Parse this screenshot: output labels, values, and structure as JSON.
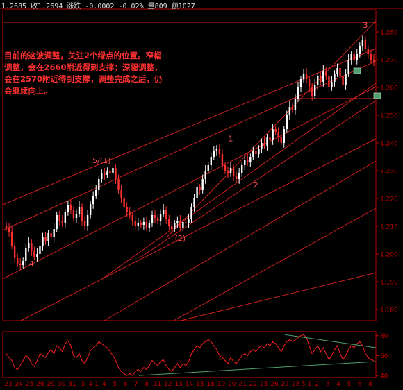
{
  "header": {
    "info": "1.2685 收1.2694 涨跌 -0.0002 -0.02% 量809 额1027"
  },
  "annotation": {
    "text": "目前的这波调整，关注2个绿点的位置。窄幅调整，会在2660附近得到支撑；深幅调整，会在2570附近得到支撑，调整完成之后，仍会继续向上。"
  },
  "colors": {
    "background": "#000000",
    "axis": "#c00000",
    "trendline": "#d02020",
    "candle_up": "#ffffff",
    "candle_down": "#ff3030",
    "wave_label": "#ff5050",
    "target": "#50a070",
    "osc_line": "#ff2020",
    "osc_trend": "#50a070"
  },
  "chart_data": [
    {
      "type": "candlestick",
      "title": "",
      "ylim": [
        1.176,
        1.288
      ],
      "yticks": [
        1.18,
        1.19,
        1.2,
        1.21,
        1.22,
        1.23,
        1.24,
        1.25,
        1.26,
        1.27,
        1.28
      ],
      "ytick_labels": [
        "1.180",
        "1.190",
        "1.200",
        "1.210",
        "1.220",
        "1.230",
        "1.240",
        "1.250",
        "1.260",
        "1.270",
        "1.280"
      ],
      "x_labels": [
        "23",
        "24",
        "25",
        "26",
        "29",
        "30",
        "31",
        "3",
        "4-1",
        "4",
        "5",
        "6",
        "7",
        "8",
        "11",
        "12",
        "13",
        "14",
        "15",
        "18",
        "19",
        "20",
        "21",
        "22",
        "25",
        "26",
        "27",
        "28",
        "5-1",
        "2",
        "3",
        "4",
        "5",
        "6",
        "8"
      ],
      "closes": [
        1.2095,
        1.208,
        1.203,
        1.1985,
        1.1965,
        1.196,
        1.1975,
        1.202,
        1.204,
        1.201,
        1.199,
        1.2,
        1.203,
        1.206,
        1.2045,
        1.2075,
        1.206,
        1.209,
        1.214,
        1.212,
        1.211,
        1.215,
        1.2175,
        1.216,
        1.213,
        1.2145,
        1.217,
        1.212,
        1.21,
        1.214,
        1.218,
        1.221,
        1.223,
        1.227,
        1.229,
        1.2285,
        1.23,
        1.229,
        1.231,
        1.227,
        1.223,
        1.22,
        1.217,
        1.215,
        1.214,
        1.212,
        1.21,
        1.211,
        1.2105,
        1.2115,
        1.2095,
        1.211,
        1.214,
        1.213,
        1.212,
        1.2145,
        1.216,
        1.2125,
        1.21,
        1.209,
        1.211,
        1.212,
        1.2095,
        1.2115,
        1.211,
        1.2125,
        1.217,
        1.22,
        1.224,
        1.223,
        1.227,
        1.23,
        1.232,
        1.235,
        1.237,
        1.238,
        1.236,
        1.232,
        1.23,
        1.229,
        1.231,
        1.228,
        1.227,
        1.229,
        1.232,
        1.234,
        1.233,
        1.235,
        1.237,
        1.236,
        1.238,
        1.24,
        1.239,
        1.242,
        1.241,
        1.245,
        1.244,
        1.242,
        1.24,
        1.245,
        1.25,
        1.253,
        1.252,
        1.256,
        1.26,
        1.263,
        1.265,
        1.263,
        1.26,
        1.257,
        1.261,
        1.264,
        1.262,
        1.266,
        1.264,
        1.26,
        1.262,
        1.265,
        1.267,
        1.264,
        1.261,
        1.265,
        1.27,
        1.272,
        1.27,
        1.272,
        1.275,
        1.277,
        1.274,
        1.272,
        1.27,
        1.2694
      ],
      "wave_labels": [
        {
          "text": "4",
          "x_index": 9,
          "y": 1.1955
        },
        {
          "text": "5/(1)",
          "x_index": 34,
          "y": 1.2328
        },
        {
          "text": "(2)",
          "x_index": 62,
          "y": 1.2048
        },
        {
          "text": "1",
          "x_index": 80,
          "y": 1.2406
        },
        {
          "text": "2",
          "x_index": 89,
          "y": 1.224
        },
        {
          "text": "3",
          "x_index": 128,
          "y": 1.2815
        }
      ],
      "targets": [
        {
          "label": "2660",
          "y": 1.266
        },
        {
          "label": "2570",
          "y": 1.257
        }
      ]
    },
    {
      "type": "line",
      "title": "",
      "ylim": [
        38,
        84
      ],
      "yticks": [
        40,
        60,
        80
      ],
      "ytick_labels": [
        "40",
        "60",
        "80"
      ],
      "values": [
        62,
        58,
        55,
        48,
        46,
        50,
        55,
        60,
        58,
        52,
        49,
        55,
        62,
        60,
        58,
        63,
        66,
        62,
        70,
        68,
        64,
        72,
        75,
        70,
        60,
        58,
        62,
        55,
        52,
        58,
        65,
        68,
        70,
        74,
        72,
        70,
        68,
        64,
        60,
        55,
        48,
        44,
        42,
        40,
        42,
        40,
        44,
        46,
        44,
        48,
        46,
        50,
        55,
        52,
        50,
        54,
        56,
        50,
        46,
        44,
        48,
        52,
        48,
        52,
        50,
        54,
        62,
        66,
        70,
        68,
        72,
        74,
        76,
        74,
        70,
        66,
        60,
        58,
        55,
        52,
        58,
        54,
        52,
        56,
        60,
        62,
        60,
        64,
        66,
        64,
        68,
        70,
        68,
        72,
        70,
        74,
        72,
        68,
        64,
        70,
        74,
        76,
        74,
        76,
        78,
        80,
        81,
        78,
        70,
        62,
        66,
        70,
        64,
        68,
        62,
        56,
        60,
        66,
        70,
        62,
        56,
        60,
        66,
        70,
        68,
        72,
        74,
        70,
        62,
        58,
        56,
        55
      ]
    }
  ]
}
